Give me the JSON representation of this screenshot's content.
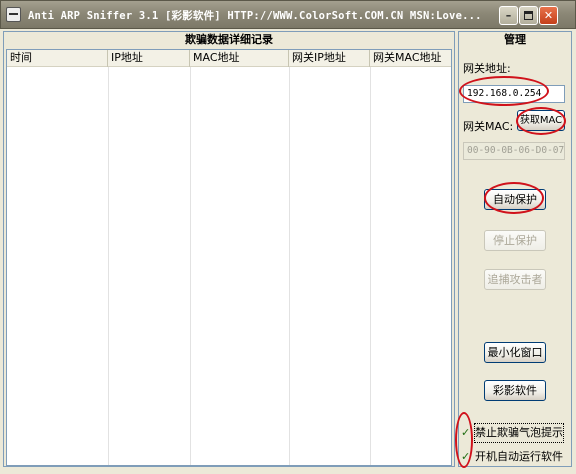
{
  "window": {
    "title": "Anti ARP Sniffer 3.1   [彩影软件]  HTTP://WWW.ColorSoft.COM.CN   MSN:Love...",
    "buttons": {
      "minimize": "–",
      "close": "✕"
    }
  },
  "log_panel": {
    "title": "欺骗数据详细记录",
    "columns": [
      "时间",
      "IP地址",
      "MAC地址",
      "网关IP地址",
      "网关MAC地址"
    ],
    "rows": []
  },
  "manage_panel": {
    "title": "管理",
    "gateway_ip_label": "网关地址:",
    "gateway_ip_value": "192.168.0.254",
    "gateway_mac_label": "网关MAC:",
    "get_mac_button": "获取MAC",
    "gateway_mac_value": "00-90-0B-06-D0-07",
    "auto_protect_button": "自动保护",
    "stop_protect_button": "停止保护",
    "trace_attacker_button": "追捕攻击者",
    "minimize_window_button": "最小化窗口",
    "colorsoft_button": "彩影软件",
    "options": [
      {
        "label": "禁止欺骗气泡提示",
        "checked": true
      },
      {
        "label": "开机自动运行软件",
        "checked": true
      }
    ]
  },
  "colors": {
    "annotation": "#d0121b",
    "titlebar": "#8c8877",
    "border": "#7f9db9"
  },
  "icons": [
    "app-icon",
    "minimize-icon",
    "maximize-icon",
    "close-icon",
    "check-icon"
  ]
}
